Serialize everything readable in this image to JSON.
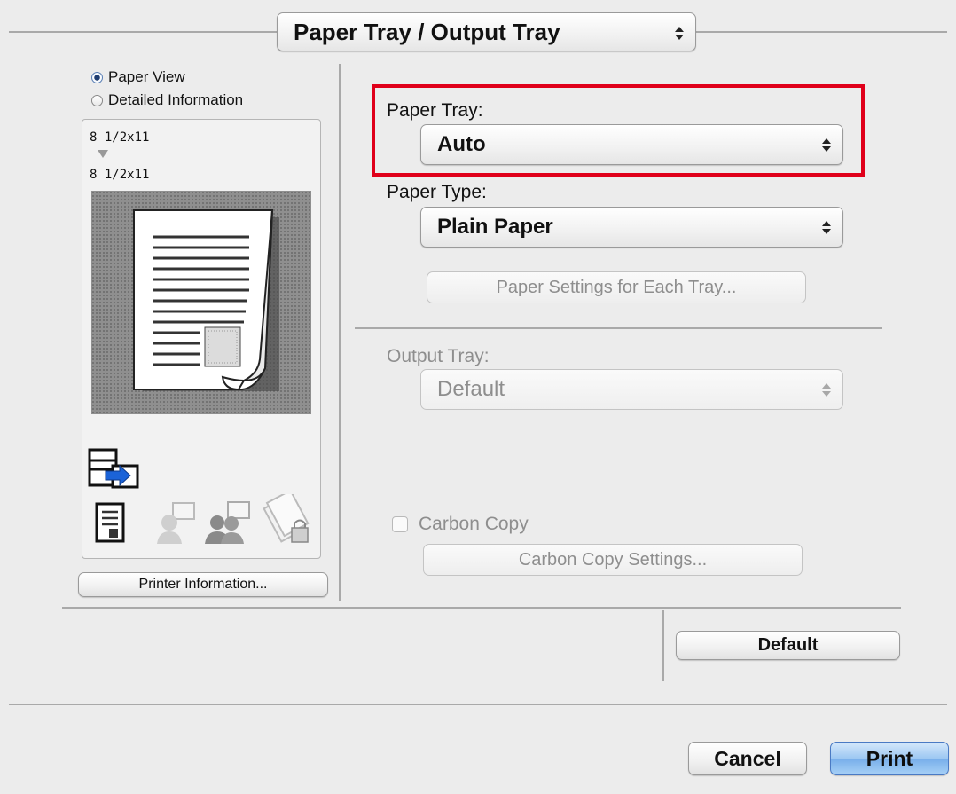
{
  "header": {
    "selector_value": "Paper Tray / Output Tray"
  },
  "preview": {
    "view_options": [
      {
        "label": "Paper View",
        "selected": true
      },
      {
        "label": "Detailed Information",
        "selected": false
      }
    ],
    "original_size": "8 1/2x11",
    "output_size": "8 1/2x11",
    "printer_info_label": "Printer Information..."
  },
  "settings": {
    "paper_tray": {
      "label": "Paper Tray:",
      "value": "Auto"
    },
    "paper_type": {
      "label": "Paper Type:",
      "value": "Plain Paper"
    },
    "paper_settings_button": "Paper Settings for Each Tray...",
    "output_tray": {
      "label": "Output Tray:",
      "value": "Default",
      "enabled": false
    },
    "carbon_copy": {
      "label": "Carbon Copy",
      "checked": false,
      "enabled": false
    },
    "carbon_copy_settings_button": "Carbon Copy Settings..."
  },
  "footer": {
    "default_label": "Default",
    "cancel_label": "Cancel",
    "print_label": "Print"
  },
  "colors": {
    "highlight_box": "#e0001a",
    "print_button": "#7aaeea"
  }
}
